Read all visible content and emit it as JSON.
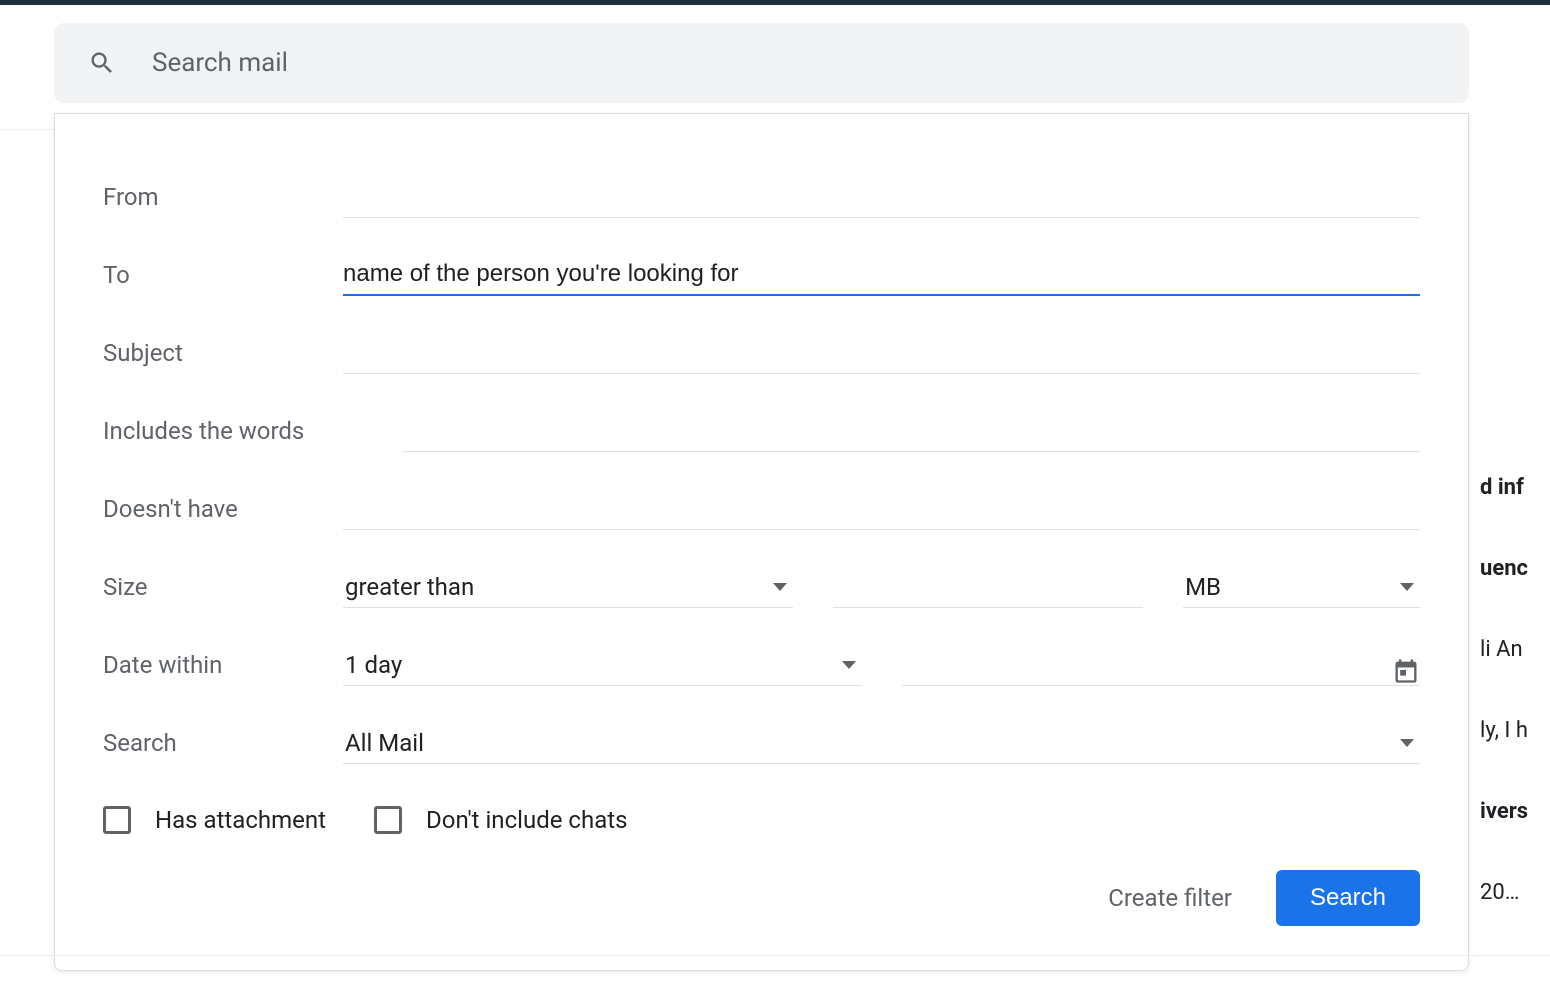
{
  "search": {
    "placeholder": "Search mail"
  },
  "form": {
    "from": {
      "label": "From",
      "value": ""
    },
    "to": {
      "label": "To",
      "value": "name of the person you're looking for"
    },
    "subject": {
      "label": "Subject",
      "value": ""
    },
    "includes": {
      "label": "Includes the words",
      "value": ""
    },
    "doesnt_have": {
      "label": "Doesn't have",
      "value": ""
    },
    "size": {
      "label": "Size",
      "operator": "greater than",
      "value": "",
      "unit": "MB"
    },
    "date": {
      "label": "Date within",
      "range": "1 day",
      "value": ""
    },
    "search_in": {
      "label": "Search",
      "value": "All Mail"
    },
    "has_attachment": {
      "label": "Has attachment",
      "checked": false
    },
    "exclude_chats": {
      "label": "Don't include chats",
      "checked": false
    }
  },
  "actions": {
    "create_filter": "Create filter",
    "search": "Search"
  },
  "bg_mail_fragments": [
    "d inf",
    "uenc",
    "li An",
    "ly, I h",
    "ivers",
    "20…"
  ]
}
